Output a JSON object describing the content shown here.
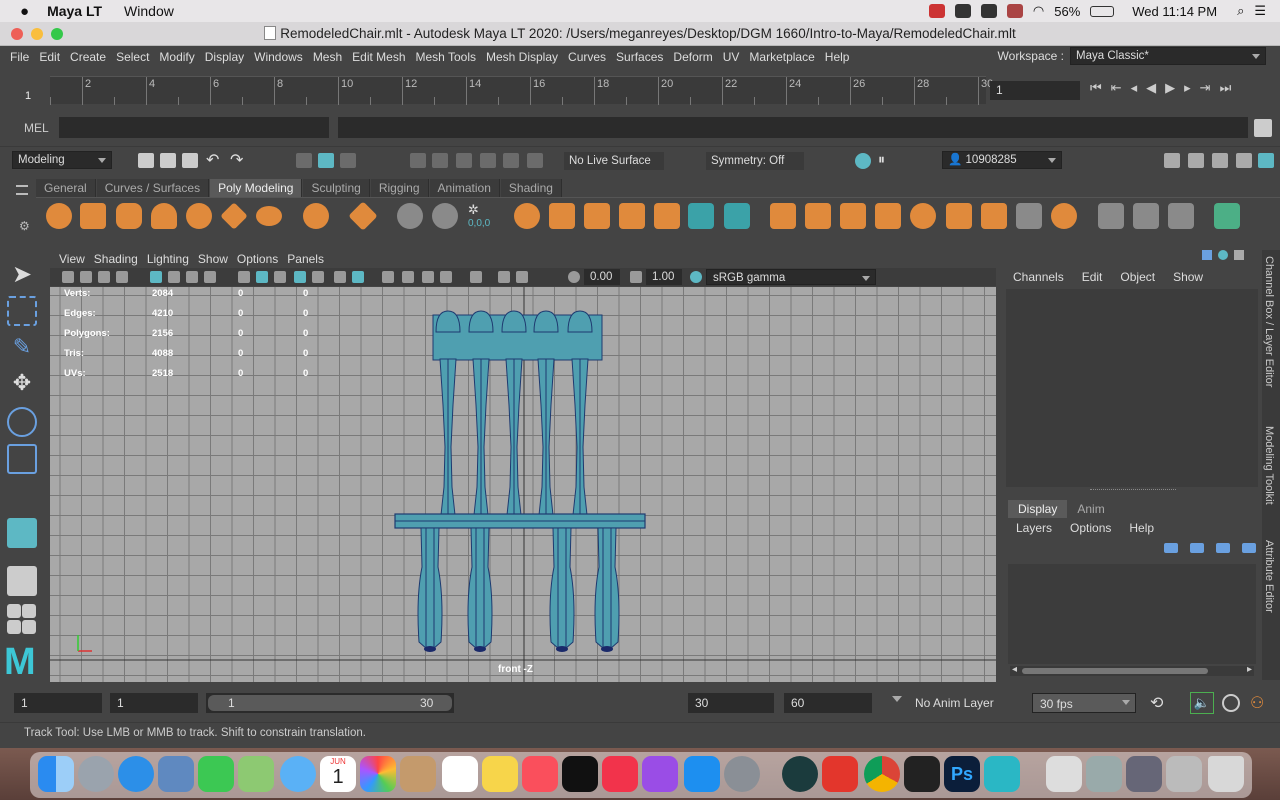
{
  "mac_menubar": {
    "app_name": "Maya LT",
    "menu_window": "Window",
    "battery": "56%",
    "clock": "Wed 11:14 PM"
  },
  "window_title": "RemodeledChair.mlt - Autodesk Maya LT 2020: /Users/meganreyes/Desktop/DGM 1660/Intro-to-Maya/RemodeledChair.mlt",
  "main_menu": {
    "items": [
      "File",
      "Edit",
      "Create",
      "Select",
      "Modify",
      "Display",
      "Windows",
      "Mesh",
      "Edit Mesh",
      "Mesh Tools",
      "Mesh Display",
      "Curves",
      "Surfaces",
      "Deform",
      "UV",
      "Marketplace",
      "Help"
    ],
    "workspace_label": "Workspace :",
    "workspace_value": "Maya Classic*"
  },
  "timeline": {
    "labels": [
      "2",
      "4",
      "6",
      "8",
      "10",
      "12",
      "14",
      "16",
      "18",
      "20",
      "22",
      "24",
      "26",
      "28",
      "30"
    ],
    "current_frame_marker": "1",
    "current_frame": "1"
  },
  "command_line": {
    "mel_label": "MEL"
  },
  "status_line": {
    "mode": "Modeling",
    "live_surface": "No Live Surface",
    "symmetry": "Symmetry: Off",
    "user_id": "10908285"
  },
  "shelf": {
    "tabs": [
      "General",
      "Curves / Surfaces",
      "Poly Modeling",
      "Sculpting",
      "Rigging",
      "Animation",
      "Shading"
    ],
    "active_tab": "Poly Modeling",
    "icon_label_xyz": "0,0,0"
  },
  "viewport": {
    "menu": [
      "View",
      "Shading",
      "Lighting",
      "Show",
      "Options",
      "Panels"
    ],
    "exposure": "0.00",
    "gamma": "1.00",
    "color_space": "sRGB gamma",
    "camera_label": "front -Z",
    "hud": [
      {
        "label": "Verts:",
        "v1": "2084",
        "v2": "0",
        "v3": "0"
      },
      {
        "label": "Edges:",
        "v1": "4210",
        "v2": "0",
        "v3": "0"
      },
      {
        "label": "Polygons:",
        "v1": "2156",
        "v2": "0",
        "v3": "0"
      },
      {
        "label": "Tris:",
        "v1": "4088",
        "v2": "0",
        "v3": "0"
      },
      {
        "label": "UVs:",
        "v1": "2518",
        "v2": "0",
        "v3": "0"
      }
    ]
  },
  "channel_box": {
    "menu": [
      "Channels",
      "Edit",
      "Object",
      "Show"
    ]
  },
  "layer_editor": {
    "tabs": [
      "Display",
      "Anim"
    ],
    "active_tab": "Display",
    "menu": [
      "Layers",
      "Options",
      "Help"
    ]
  },
  "side_tabs": [
    "Channel Box / Layer Editor",
    "Modeling Toolkit",
    "Attribute Editor"
  ],
  "range_slider": {
    "start": "1",
    "range_start": "1",
    "range_handle_start": "1",
    "range_handle_end": "30",
    "range_end": "30",
    "end": "60",
    "anim_layer": "No Anim Layer",
    "fps": "30 fps"
  },
  "help_line": "Track Tool: Use LMB or MMB to track. Shift to constrain translation.",
  "dock": {
    "calendar_month": "JUN",
    "calendar_day": "1",
    "ps_label": "Ps"
  },
  "colors": {
    "accent": "#5db8c4",
    "mesh": "#4f9fb0",
    "mesh_wire": "#1e3a70",
    "shelf_orange": "#e08a3c"
  }
}
